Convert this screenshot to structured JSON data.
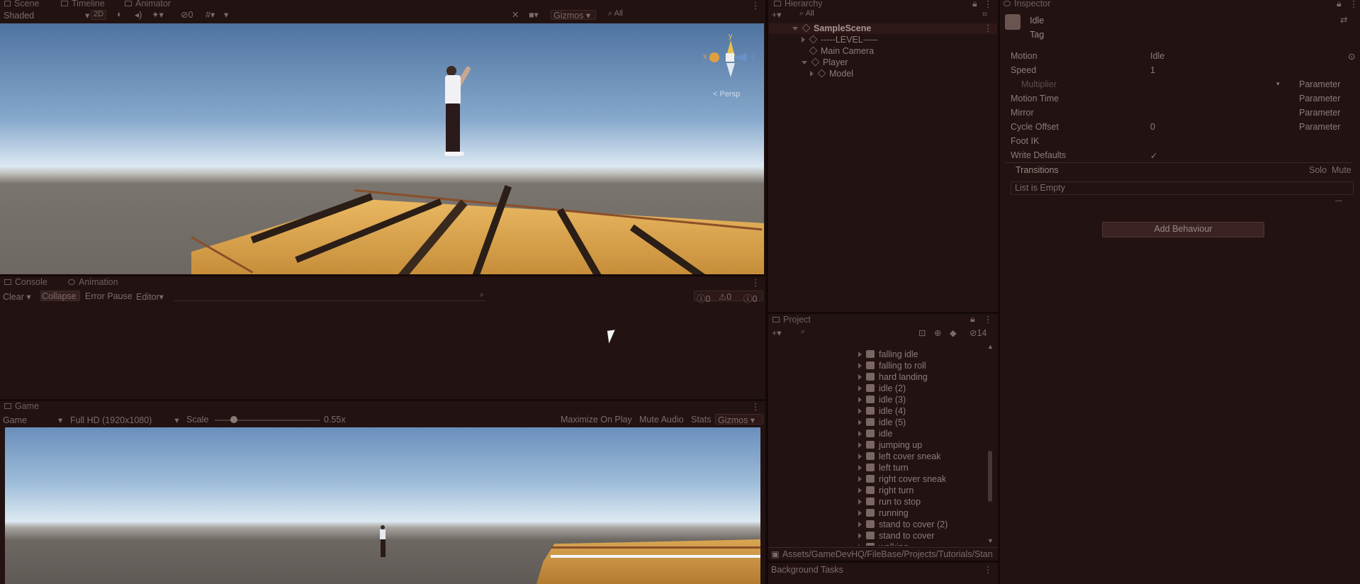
{
  "colors": {
    "background": "#231212",
    "panel_text": "#8c7c78",
    "sky_top": "#5a7fa8",
    "sky_horizon": "#d8e6f0",
    "ground": "#6e6862",
    "platform": "#e0ac52",
    "gizmo_x": "#e0a040",
    "gizmo_y": "#e8c050",
    "gizmo_z": "#6a90c8"
  },
  "scene_tabs": {
    "tabs": [
      "Scene",
      "Timeline",
      "Animator"
    ],
    "shading_mode": "Shaded",
    "mode_2d": "2D",
    "hidden_count": "0",
    "gizmos": "Gizmos",
    "persp_label": "< Persp",
    "gizmo_axes": {
      "x": "x",
      "y": "y",
      "z": "z"
    }
  },
  "hierarchy": {
    "title": "Hierarchy",
    "search_hint": "All",
    "items": [
      {
        "label": "SampleScene",
        "level": 0
      },
      {
        "label": "-----LEVEL-----",
        "level": 1
      },
      {
        "label": "Main Camera",
        "level": 1
      },
      {
        "label": "Player",
        "level": 1
      },
      {
        "label": "Model",
        "level": 2
      }
    ]
  },
  "inspector": {
    "title": "Inspector",
    "state_name": "Idle",
    "tag_label": "Tag",
    "fields": [
      {
        "label": "Motion",
        "value": "Idle",
        "param": ""
      },
      {
        "label": "Speed",
        "value": "1",
        "param": ""
      },
      {
        "label": "Multiplier",
        "value": "",
        "param": "Parameter"
      },
      {
        "label": "Motion Time",
        "value": "",
        "param": "Parameter"
      },
      {
        "label": "Mirror",
        "value": "",
        "param": "Parameter"
      },
      {
        "label": "Cycle Offset",
        "value": "0",
        "param": "Parameter"
      },
      {
        "label": "Foot IK",
        "value": "",
        "param": ""
      },
      {
        "label": "Write Defaults",
        "value": "✓",
        "param": ""
      }
    ],
    "transitions_label": "Transitions",
    "solo_label": "Solo",
    "mute_label": "Mute",
    "list_empty": "List is Empty",
    "minus_label": "—",
    "add_behaviour": "Add Behaviour"
  },
  "console": {
    "tabs": [
      "Console",
      "Animation"
    ],
    "clear": "Clear",
    "collapse": "Collapse",
    "error_pause": "Error Pause",
    "editor": "Editor",
    "counts": {
      "info": "0",
      "warn": "0",
      "error": "0"
    }
  },
  "game": {
    "tab": "Game",
    "display": "Game",
    "resolution": "Full HD (1920x1080)",
    "scale_label": "Scale",
    "scale_value": "0.55x",
    "scale_fraction": 0.13,
    "maximize": "Maximize On Play",
    "mute": "Mute Audio",
    "stats": "Stats",
    "gizmos": "Gizmos"
  },
  "project": {
    "title": "Project",
    "hidden_count": "14",
    "items": [
      "falling idle",
      "falling to roll",
      "hard landing",
      "idle (2)",
      "idle (3)",
      "idle (4)",
      "idle (5)",
      "idle",
      "jumping up",
      "left cover sneak",
      "left turn",
      "right cover sneak",
      "right turn",
      "run to stop",
      "running",
      "stand to cover (2)",
      "stand to cover",
      "walking"
    ],
    "path": "Assets/GameDevHQ/FileBase/Projects/Tutorials/Stan",
    "background_tasks": "Background Tasks"
  }
}
